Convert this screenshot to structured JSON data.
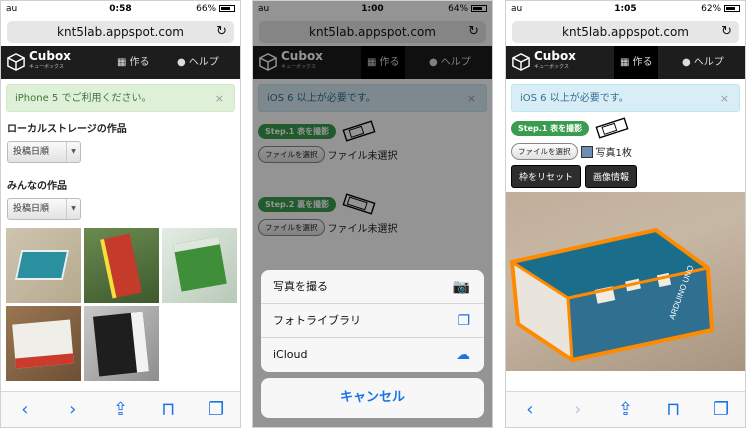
{
  "phone1": {
    "status": {
      "carrier": "au",
      "time": "0:58",
      "battery": "66%",
      "battery_fill": 0.66
    },
    "url": "knt5lab.appspot.com",
    "nav": {
      "logo_title": "Cubox",
      "logo_sub": "キューボックス",
      "make": "作る",
      "help": "ヘルプ"
    },
    "alert": "iPhone 5 でご利用ください。",
    "alert_close": "×",
    "local_heading": "ローカルストレージの作品",
    "local_sort": "投稿日順",
    "everyone_heading": "みんなの作品",
    "everyone_sort": "投稿日順"
  },
  "phone2": {
    "status": {
      "carrier": "au",
      "time": "1:00",
      "battery": "64%",
      "battery_fill": 0.64
    },
    "url": "knt5lab.appspot.com",
    "nav": {
      "logo_title": "Cubox",
      "logo_sub": "キューボックス",
      "make": "作る",
      "help": "ヘルプ"
    },
    "alert": "iOS 6 以上が必要です。",
    "alert_close": "×",
    "step1": "Step.1 表を撮影",
    "step2": "Step.2 裏を撮影",
    "file_button": "ファイルを選択",
    "no_file": "ファイル未選択",
    "sheet": {
      "take_photo": "写真を撮る",
      "photo_library": "フォトライブラリ",
      "icloud": "iCloud",
      "cancel": "キャンセル"
    }
  },
  "phone3": {
    "status": {
      "carrier": "au",
      "time": "1:05",
      "battery": "62%",
      "battery_fill": 0.62
    },
    "url": "knt5lab.appspot.com",
    "nav": {
      "logo_title": "Cubox",
      "logo_sub": "キューボックス",
      "make": "作る",
      "help": "ヘルプ"
    },
    "alert": "iOS 6 以上が必要です。",
    "alert_close": "×",
    "step1": "Step.1 表を撮影",
    "file_button": "ファイルを選択",
    "file_count": "写真1枚",
    "reset_button": "枠をリセット",
    "info_button": "画像情報",
    "box_label": "ARDUINO UNO"
  },
  "icons": {
    "reload": "↻",
    "grid": "▦",
    "help": "●",
    "back": "‹",
    "forward": "›",
    "share": "⇪",
    "bookmarks": "⊓",
    "tabs": "❐"
  },
  "colors": {
    "accent": "#1a73e8",
    "step_green": "#3a9c4f",
    "navbar": "#1d1d1d",
    "frame_orange": "#ff8a00"
  }
}
